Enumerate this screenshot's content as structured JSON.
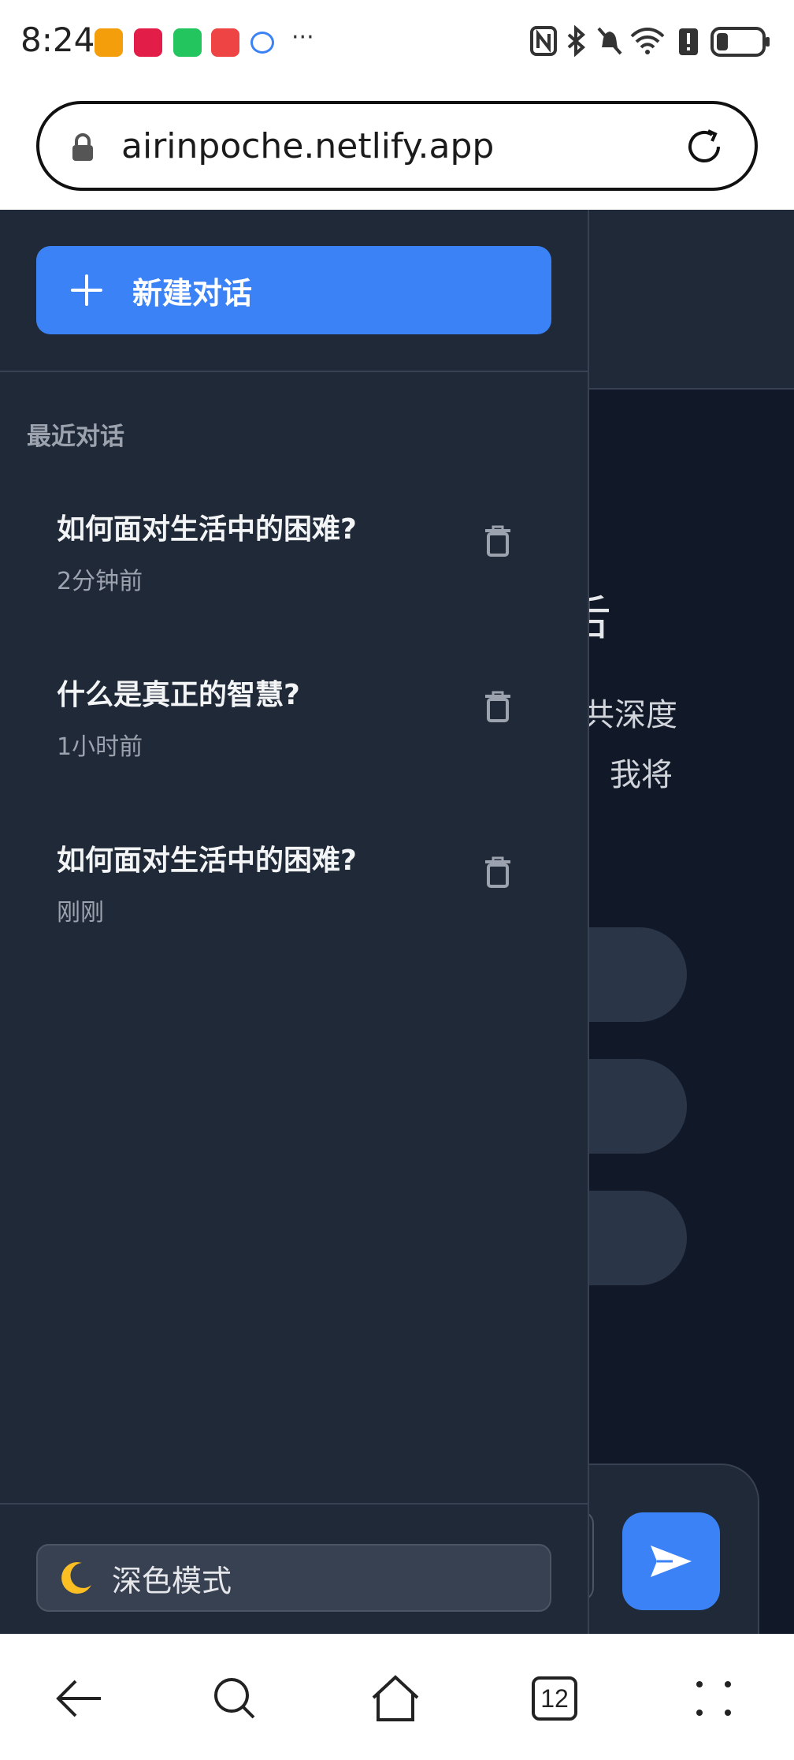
{
  "status_bar": {
    "time": "8:24",
    "more": "···",
    "icons": [
      "nfc-icon",
      "bluetooth-icon",
      "mute-icon",
      "wifi-icon",
      "battery-alert-icon",
      "battery-icon"
    ]
  },
  "browser": {
    "url": "airinpoche.netlify.app",
    "tabs_count": "12"
  },
  "sidebar": {
    "new_chat_label": "新建对话",
    "section_label": "最近对话",
    "conversations": [
      {
        "title": "如何面对生活中的困难?",
        "time": "2分钟前"
      },
      {
        "title": "什么是真正的智慧?",
        "time": "1小时前"
      },
      {
        "title": "如何面对生活中的困难?",
        "time": "刚刚"
      }
    ],
    "theme_toggle_label": "深色模式"
  },
  "background_chat": {
    "title_fragment": "舌",
    "text_line1_fragment": "共深度",
    "text_line2_fragment": "我将"
  },
  "colors": {
    "accent": "#3b82f6",
    "sidebar_bg": "#1f2937",
    "page_bg": "#111827"
  }
}
